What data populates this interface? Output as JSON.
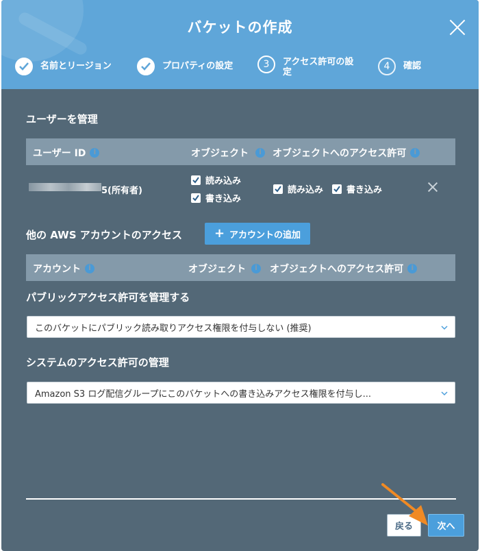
{
  "header": {
    "title": "バケットの作成",
    "steps": [
      {
        "label": "名前とリージョン",
        "state": "done"
      },
      {
        "label": "プロパティの設定",
        "state": "done"
      },
      {
        "number": "3",
        "label_line1": "アクセス許可の設",
        "label_line2": "定",
        "state": "current"
      },
      {
        "number": "4",
        "label": "確認",
        "state": "pending"
      }
    ]
  },
  "users": {
    "section_title": "ユーザーを管理",
    "columns": {
      "user_id": "ユーザー ID",
      "objects": "オブジェクト",
      "object_permissions": "オブジェクトへのアクセス許可"
    },
    "row": {
      "owner_suffix": "5(所有者)",
      "object_read": "読み込み",
      "object_write": "書き込み",
      "perm_read": "読み込み",
      "perm_write": "書き込み"
    }
  },
  "other_accounts": {
    "section_title": "他の AWS アカウントのアクセス",
    "add_button": "アカウントの追加",
    "columns": {
      "account": "アカウント",
      "objects": "オブジェクト",
      "object_permissions": "オブジェクトへのアクセス許可"
    }
  },
  "public_access": {
    "section_title": "パブリックアクセス許可を管理する",
    "selected": "このバケットにパブリック読み取りアクセス権限を付与しない (推奨)"
  },
  "system_access": {
    "section_title": "システムのアクセス許可の管理",
    "selected": "Amazon S3 ログ配信グループにこのバケットへの書き込みアクセス権限を付与し..."
  },
  "footer": {
    "back_label": "戻る",
    "next_label": "次へ"
  },
  "colors": {
    "header": "#5fa6d9",
    "body": "#536877",
    "table_header": "#849aaa",
    "primary": "#4b9fdc",
    "arrow": "#f08a24"
  },
  "icons": [
    "check-circle-icon",
    "info-icon",
    "checkbox-checked-icon",
    "close-icon",
    "plus-icon",
    "chevron-down-icon",
    "pointer-arrow-icon"
  ]
}
